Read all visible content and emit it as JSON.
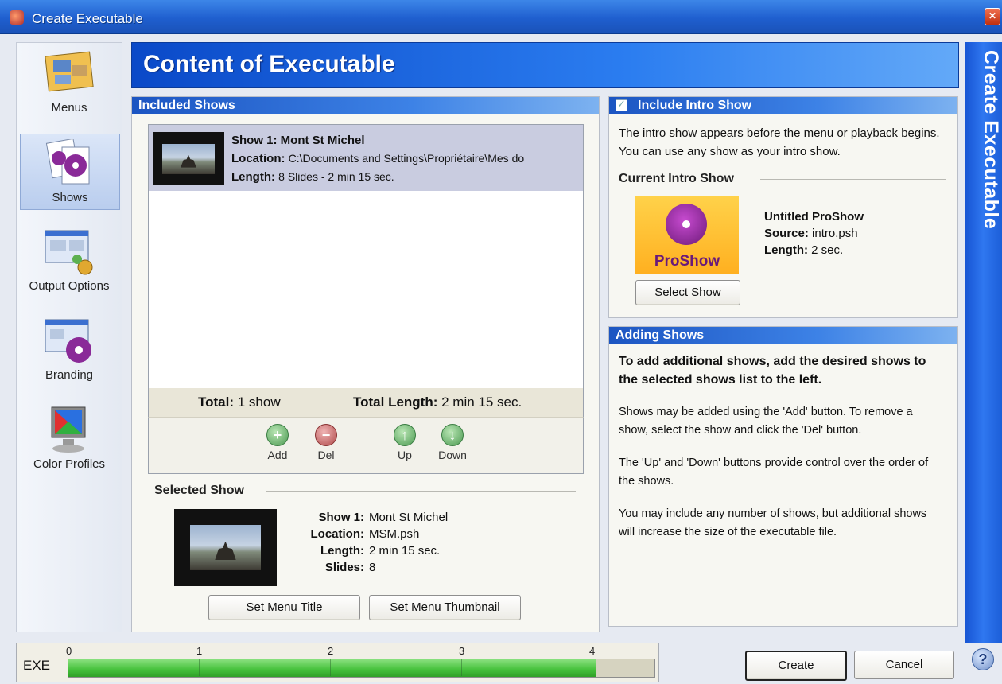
{
  "window": {
    "title": "Create Executable",
    "close_glyph": "✕"
  },
  "sidebar": {
    "items": [
      {
        "label": "Menus",
        "icon": "menus-icon"
      },
      {
        "label": "Shows",
        "icon": "shows-icon",
        "active": true
      },
      {
        "label": "Output Options",
        "icon": "output-options-icon"
      },
      {
        "label": "Branding",
        "icon": "branding-icon"
      },
      {
        "label": "Color Profiles",
        "icon": "color-profiles-icon"
      }
    ]
  },
  "header": {
    "title": "Content of Executable",
    "side_title": "Create Executable"
  },
  "included_shows": {
    "heading": "Included Shows",
    "shows": [
      {
        "title": "Show 1: Mont St Michel",
        "location_key": "Location:",
        "location_val": "C:\\Documents and Settings\\Propriétaire\\Mes do",
        "length_key": "Length:",
        "length_val": "8 Slides - 2 min 15 sec."
      }
    ],
    "total_key": "Total:",
    "total_val": "1 show",
    "total_length_key": "Total Length:",
    "total_length_val": "2 min 15 sec.",
    "buttons": {
      "add": "Add",
      "del": "Del",
      "up": "Up",
      "down": "Down"
    }
  },
  "selected_show": {
    "heading": "Selected Show",
    "rows": [
      {
        "k": "Show 1:",
        "v": "Mont St Michel"
      },
      {
        "k": "Location:",
        "v": "MSM.psh"
      },
      {
        "k": "Length:",
        "v": "2 min 15 sec."
      },
      {
        "k": "Slides:",
        "v": "8"
      }
    ],
    "set_title_btn": "Set Menu Title",
    "set_thumb_btn": "Set Menu Thumbnail"
  },
  "intro": {
    "heading": "Include Intro Show",
    "checked": true,
    "description": "The intro show appears before the menu or playback begins. You can use any show as your intro show.",
    "current_heading": "Current Intro Show",
    "logo_word": "ProShow",
    "show_name": "Untitled ProShow",
    "source_key": "Source:",
    "source_val": "intro.psh",
    "length_key": "Length:",
    "length_val": "2 sec.",
    "select_btn": "Select Show"
  },
  "adding": {
    "heading": "Adding Shows",
    "bold_text": "To add additional shows, add the desired shows to the selected shows list to the left.",
    "p1": "Shows may be added using the 'Add' button. To remove a show, select the show and click the 'Del' button.",
    "p2": "The 'Up' and 'Down' buttons provide control over the order of the shows.",
    "p3": "You may include any number of shows, but additional shows will increase the size of the executable file."
  },
  "footer": {
    "exe_label": "EXE",
    "ticks": [
      "0",
      "1",
      "2",
      "3",
      "4"
    ],
    "fill_fraction": 0.9,
    "create_btn": "Create",
    "cancel_btn": "Cancel",
    "help_glyph": "?"
  }
}
